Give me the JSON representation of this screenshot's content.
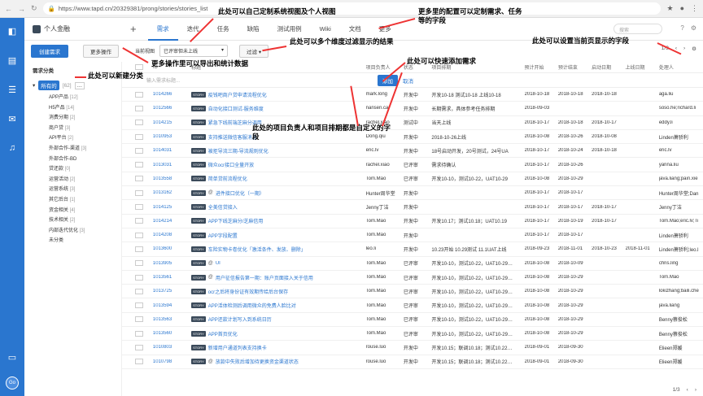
{
  "browser": {
    "url": "https://www.tapd.cn/20329381/prong/stories/stories_list"
  },
  "project": {
    "name": "个人金融"
  },
  "tabs": [
    "需求",
    "迭代",
    "任务",
    "缺陷",
    "测试用例",
    "Wiki",
    "文档",
    "更多"
  ],
  "search": {
    "placeholder": "搜索"
  },
  "toolbar": {
    "create": "创建需求",
    "more": "更多操作",
    "view_label": "当前视图",
    "view_value": "已评审但未上线",
    "filter": "过滤",
    "page": "1/3"
  },
  "sidebar": {
    "head": "需求分类",
    "root": "所有的",
    "root_count": "[62]",
    "items": [
      {
        "label": "APP产品",
        "count": "[12]"
      },
      {
        "label": "H5产品",
        "count": "[14]"
      },
      {
        "label": "消费分期",
        "count": "[2]"
      },
      {
        "label": "商户贷",
        "count": "[3]"
      },
      {
        "label": "API平台",
        "count": "[2]"
      },
      {
        "label": "外部合作-渠道",
        "count": "[3]"
      },
      {
        "label": "外部合作-BD",
        "count": ""
      },
      {
        "label": "贷还款",
        "count": "[0]"
      },
      {
        "label": "运营活动",
        "count": "[2]"
      },
      {
        "label": "运营系统",
        "count": "[3]"
      },
      {
        "label": "其它后台",
        "count": "[1]"
      },
      {
        "label": "资金相关",
        "count": "[4]"
      },
      {
        "label": "技术相关",
        "count": "[2]"
      },
      {
        "label": "内部迭代优化",
        "count": "[3]"
      },
      {
        "label": "未分类",
        "count": ""
      }
    ]
  },
  "table": {
    "headers": [
      "ID",
      "标题",
      "项目负责人",
      "状态",
      "项目排期",
      "预计开始",
      "预计结束",
      "启动日期",
      "上线日期",
      "处理人"
    ],
    "quick_add_placeholder": "输入需求标题...",
    "quick_add": "添加",
    "quick_cancel": "取消",
    "rows": [
      [
        "1014266",
        "疫钱吧商户贷申请流程优化",
        "mark.long",
        "开发中",
        "开发10-18 测试10-18 上线10-18",
        "2018-10-18",
        "2018-10-18",
        "2018-10-18",
        "",
        "aga.liu"
      ],
      [
        "1012566",
        "自动化接口测试-服务维度",
        "nansen.cai",
        "开发中",
        "长期需求，具体参考任务排期",
        "2018-09-03",
        "",
        "",
        "",
        "soso.he;richard.li"
      ],
      [
        "1014215",
        "紧急下线前端芝麻分调用",
        "rachel.xiao",
        "测试中",
        "当天上线",
        "2018-10-17",
        "2018-10-18",
        "2018-10-17",
        "",
        "eddy.li"
      ],
      [
        "1010953",
        "支持推送微信客服消息",
        "Dong.qiu",
        "开发中",
        "2018-10-26上线",
        "2018-10-08",
        "2018-10-26",
        "2018-10-08",
        "",
        "Linden萧骄利"
      ],
      [
        "1014031",
        "被拒导流三期-导流规则优化",
        "eric.lv",
        "开发中",
        "18号启动开发，20号测试，24号UA",
        "2018-10-17",
        "2018-10-24",
        "2018-10-18",
        "",
        "eric.lv"
      ],
      [
        "1013031",
        "微众ocr接口全量开放",
        "rachel.xiao",
        "已评审",
        "需求待确认",
        "2018-10-17",
        "2018-10-26",
        "",
        "",
        "yarina.liu"
      ],
      [
        "1013558",
        "简单贷前流程优化",
        "Tom.Mao",
        "已评审",
        "开发10-10，测试10-22，UAT10-29",
        "2018-10-08",
        "2018-10-29",
        "",
        "",
        "java.liang;pain.xie"
      ],
      [
        "1013162",
        "进件接口优化（一期）",
        "Hunter周华堂",
        "开发中",
        "",
        "2018-10-17",
        "2018-10-17",
        "",
        "",
        "Hunter周华堂;Dan"
      ],
      [
        "1014125",
        "全美信贷接入",
        "Jenny丁洁",
        "开发中",
        "",
        "2018-10-17",
        "2018-10-17",
        "2018-10-17",
        "",
        "Jenny丁洁"
      ],
      [
        "1014214",
        "APP下线芝麻分/芝麻信用",
        "Tom.Mao",
        "开发中",
        "开发10.17；测试10.18；UAT10.19",
        "2018-10-17",
        "2018-10-19",
        "2018-10-17",
        "",
        "Tom.Mao;eric.lv;Ti"
      ],
      [
        "1014208",
        "APP字段配置",
        "Tom.Mao",
        "开发中",
        "",
        "2018-10-17",
        "2018-10-17",
        "",
        "",
        "Linden萧骄利"
      ],
      [
        "1013600",
        "车险实物卡卷优化「激活条件、发放、删除」",
        "leo.li",
        "开发中",
        "10.23开始 10.29测试 11.1UAT上线",
        "2018-09-23",
        "2018-11-01",
        "2018-10-23",
        "2018-11-01",
        "Linden萧骄利;leo.l"
      ],
      [
        "1013905",
        "UI",
        "Tom.Mao",
        "已评审",
        "开发10-10，测试10-22，UAT10-29…",
        "2018-10-08",
        "2018-10-09",
        "",
        "",
        "chris.ling"
      ],
      [
        "1013561",
        "用户征信报告第一期：账户页面接入关于信用",
        "Tom.Mao",
        "已评审",
        "开发10-10，测试10-22，UAT10-29…",
        "2018-10-08",
        "2018-10-29",
        "",
        "",
        "Tom.Mao"
      ],
      [
        "1013725",
        "ocr之后将身份证有效期传给后台保存",
        "Tom.Mao",
        "已评审",
        "开发10-10，测试10-22，UAT10-29…",
        "2018-10-08",
        "2018-10-29",
        "",
        "",
        "lokizhang;baili.che"
      ],
      [
        "1013594",
        "APP活体检测后调用微众的免费人脸比对",
        "Tom.Mao",
        "已评审",
        "开发10-10，测试10-22，UAT10-29…",
        "2018-10-08",
        "2018-10-29",
        "",
        "",
        "java.liang"
      ],
      [
        "1013563",
        "APP还款计划写入到系统日历",
        "Tom.Mao",
        "已评审",
        "开发10-10，测试10-22，UAT10-29…",
        "2018-10-08",
        "2018-10-29",
        "",
        "",
        "Benny蔡俊松"
      ],
      [
        "1013560",
        "APP首页优化",
        "Tom.Mao",
        "已评审",
        "开发10-10，测试10-22，UAT10-29…",
        "2018-10-08",
        "2018-10-29",
        "",
        "",
        "Benny蔡俊松"
      ],
      [
        "1010803",
        "新增用户通道列表支持换卡",
        "rouse.luo",
        "开发中",
        "开发10.15；联调10.18；测试10.22…",
        "2018-09-01",
        "2018-09-30",
        "",
        "",
        "Elieen郑媛"
      ],
      [
        "1010798",
        "放款中失败后增加待更换资金渠道状态",
        "rouse.luo",
        "开发中",
        "开发10.15；联调10.18；测试10.22…",
        "2018-09-01",
        "2018-09-30",
        "",
        "",
        "Elieen郑媛"
      ]
    ],
    "tagged": [
      7,
      12,
      13,
      19
    ]
  },
  "annotations": {
    "a1": "此处可以自己定制系统视图及个人视图",
    "a2": "更多里的配置可以定制需求、任务等的字段",
    "a3": "更多操作里可以导出和统计数据",
    "a4": "此处可以多个维度过滤显示的结果",
    "a5": "此处可以设置当前页显示的字段",
    "a6": "此处可以新建分类",
    "a7": "此处可以快速添加需求",
    "a8": "此处的项目负责人和项目排期都是自定义的字段"
  },
  "footer": {
    "page": "1/3"
  },
  "tag_text": "STORY"
}
